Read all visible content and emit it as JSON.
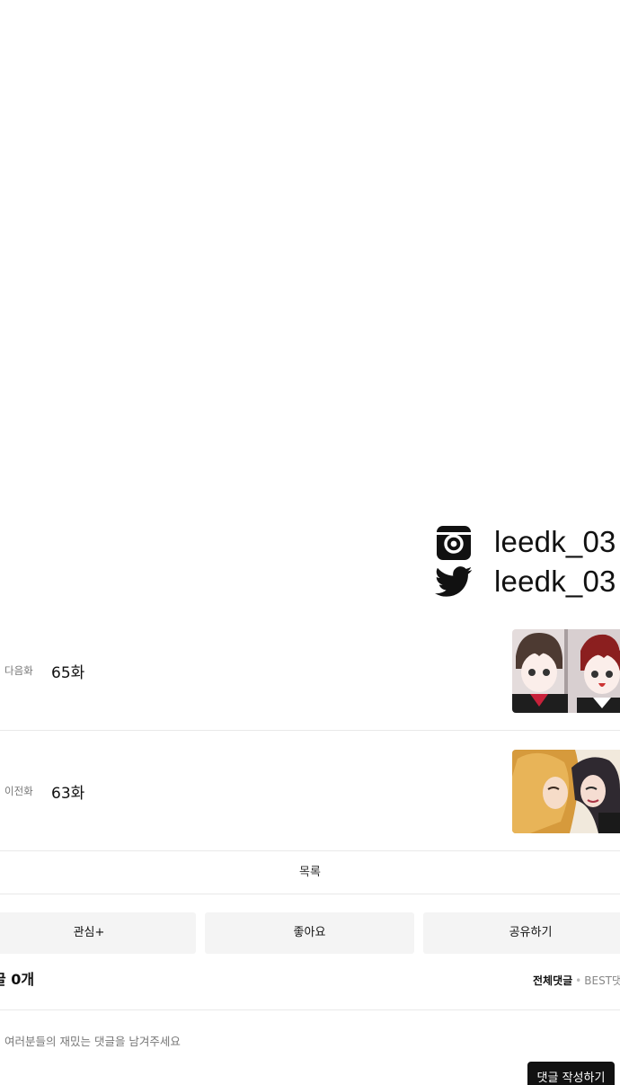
{
  "social": {
    "instagram": {
      "icon": "instagram-icon",
      "handle": "leedk_03"
    },
    "twitter": {
      "icon": "twitter-icon",
      "handle": "leedk_03"
    }
  },
  "navigation": {
    "next": {
      "label": "다음화",
      "title": "65화"
    },
    "prev": {
      "label": "이전화",
      "title": "63화"
    },
    "list_label": "목록"
  },
  "actions": {
    "subscribe_label": "관심+",
    "like_label": "좋아요",
    "share_label": "공유하기"
  },
  "comments": {
    "count_text": "글 0개",
    "sort_all": "전체댓글",
    "sort_best": "BEST댓",
    "input_placeholder": "여러분들의 재밌는 댓글을 남겨주세요",
    "input_value": "",
    "submit_label": "댓글 작성하기"
  },
  "colors": {
    "background": "#ffffff",
    "text": "#111111",
    "muted": "#777777",
    "divider": "#e9e9e9",
    "button_bg": "#f4f4f4",
    "submit_bg": "#111111"
  }
}
